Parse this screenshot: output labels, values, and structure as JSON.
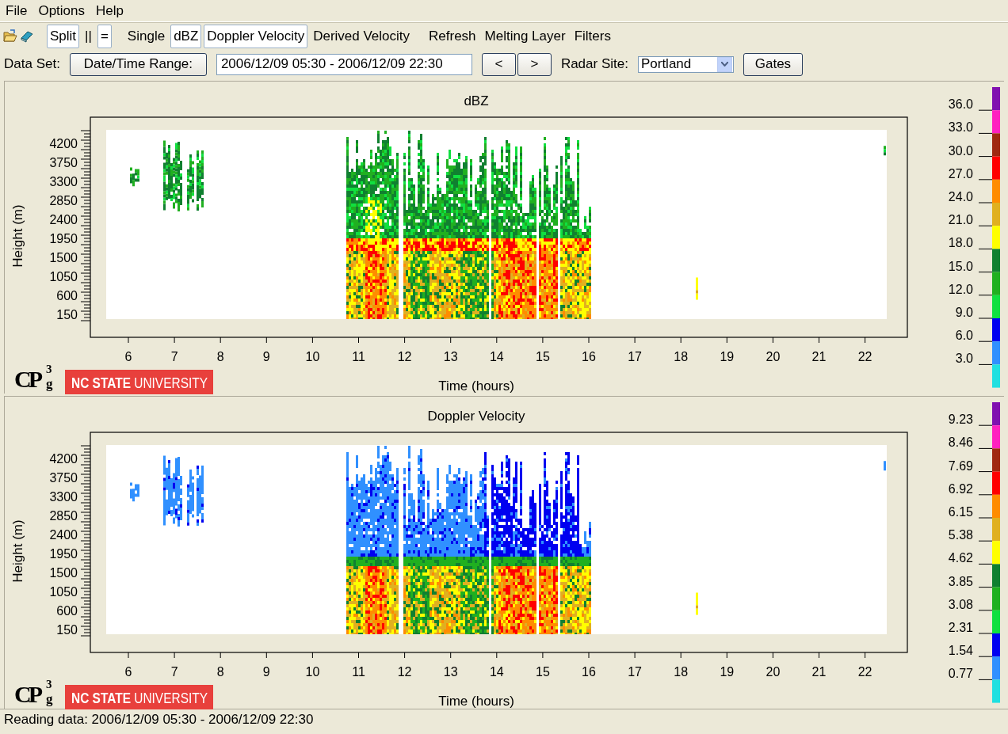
{
  "menu": [
    "File",
    "Options",
    "Help"
  ],
  "toolbar": {
    "groups": [
      [
        {
          "label": "Split",
          "selected": true
        },
        {
          "label": "||",
          "selected": false
        },
        {
          "label": "=",
          "selected": true
        }
      ],
      [
        {
          "label": "Single",
          "selected": false
        },
        {
          "label": "dBZ",
          "selected": true
        },
        {
          "label": "Doppler Velocity",
          "selected": true
        },
        {
          "label": "Derived Velocity",
          "selected": false
        }
      ],
      [
        {
          "label": "Refresh",
          "selected": false
        },
        {
          "label": "Melting Layer",
          "selected": false
        },
        {
          "label": "Filters",
          "selected": false
        }
      ]
    ]
  },
  "dataset": {
    "label": "Data Set:",
    "range_button": "Date/Time Range:",
    "range_value": "2006/12/09 05:30 - 2006/12/09 22:30",
    "prev": "<",
    "next": ">",
    "site_label": "Radar Site:",
    "site": "Portland",
    "gates": "Gates"
  },
  "panels": [
    {
      "title": "dBZ",
      "kind": "reflectivity",
      "ylabel": "Height (m)",
      "xlabel": "Time (hours)",
      "yticks": [
        "4200",
        "3750",
        "3300",
        "2850",
        "2400",
        "1950",
        "1500",
        "1050",
        "600",
        "150"
      ],
      "xticks": [
        "6",
        "7",
        "8",
        "9",
        "10",
        "11",
        "12",
        "13",
        "14",
        "15",
        "16",
        "17",
        "18",
        "19",
        "20",
        "21",
        "22"
      ],
      "logo": {
        "main": "CP",
        "sup": "3",
        "sub": "g",
        "banner_bold": "NC STATE",
        "banner_light": "UNIVERSITY"
      },
      "legend": {
        "labels": [
          "36.0",
          "33.0",
          "30.0",
          "27.0",
          "24.0",
          "21.0",
          "18.0",
          "15.0",
          "12.0",
          "9.0",
          "6.0",
          "3.0"
        ],
        "segments": [
          {
            "color": "#8010b0"
          },
          {
            "color": "#ff20c0"
          },
          {
            "color": "#a02810"
          },
          {
            "color": "#ff0000"
          },
          {
            "color": "#ff8c00"
          },
          {
            "color": "#e0b020"
          },
          {
            "color": "#ffff00"
          },
          {
            "color": "#108030"
          },
          {
            "color": "#20b020"
          },
          {
            "color": "#10e040"
          },
          {
            "color": "#0000f0"
          },
          {
            "color": "#3090ff"
          },
          {
            "color": "#20e0e0"
          }
        ]
      }
    },
    {
      "title": "Doppler Velocity",
      "kind": "velocity",
      "ylabel": "Height (m)",
      "xlabel": "Time (hours)",
      "yticks": [
        "4200",
        "3750",
        "3300",
        "2850",
        "2400",
        "1950",
        "1500",
        "1050",
        "600",
        "150"
      ],
      "xticks": [
        "6",
        "7",
        "8",
        "9",
        "10",
        "11",
        "12",
        "13",
        "14",
        "15",
        "16",
        "17",
        "18",
        "19",
        "20",
        "21",
        "22"
      ],
      "logo": {
        "main": "CP",
        "sup": "3",
        "sub": "g",
        "banner_bold": "NC STATE",
        "banner_light": "UNIVERSITY"
      },
      "legend": {
        "labels": [
          "9.23",
          "8.46",
          "7.69",
          "6.92",
          "6.15",
          "5.38",
          "4.62",
          "3.85",
          "3.08",
          "2.31",
          "1.54",
          "0.77"
        ],
        "segments": [
          {
            "color": "#8010b0"
          },
          {
            "color": "#ff20c0"
          },
          {
            "color": "#a02810"
          },
          {
            "color": "#ff0000"
          },
          {
            "color": "#ff8c00"
          },
          {
            "color": "#e0b020"
          },
          {
            "color": "#ffff00"
          },
          {
            "color": "#108030"
          },
          {
            "color": "#20b020"
          },
          {
            "color": "#10e040"
          },
          {
            "color": "#0000f0"
          },
          {
            "color": "#3090ff"
          },
          {
            "color": "#20e0e0"
          }
        ]
      }
    }
  ],
  "status": "Reading data: 2006/12/09 05:30 - 2006/12/09 22:30"
}
